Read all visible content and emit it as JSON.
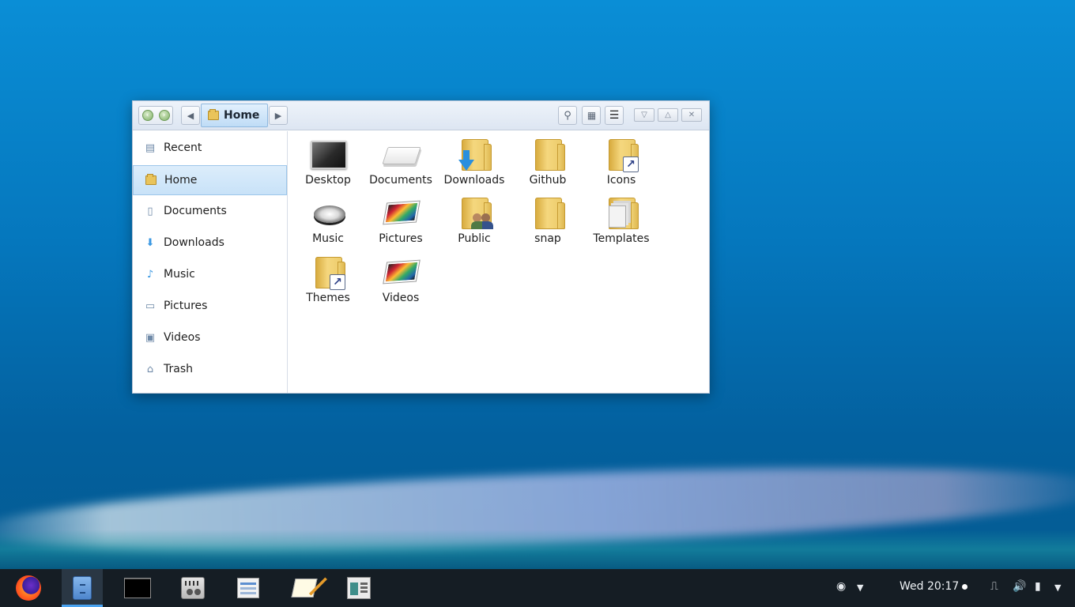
{
  "window": {
    "location": "Home"
  },
  "sidebar": {
    "items": [
      {
        "label": "Recent",
        "icon": "recent-icon"
      },
      {
        "label": "Home",
        "icon": "home-folder-icon"
      },
      {
        "label": "Documents",
        "icon": "document-icon"
      },
      {
        "label": "Downloads",
        "icon": "download-icon"
      },
      {
        "label": "Music",
        "icon": "music-note-icon"
      },
      {
        "label": "Pictures",
        "icon": "picture-icon"
      },
      {
        "label": "Videos",
        "icon": "video-icon"
      },
      {
        "label": "Trash",
        "icon": "trash-icon"
      }
    ],
    "active_index": 1
  },
  "files": [
    {
      "label": "Desktop",
      "icon": "desktop-icon"
    },
    {
      "label": "Documents",
      "icon": "documents-folder-icon"
    },
    {
      "label": "Downloads",
      "icon": "downloads-folder-icon"
    },
    {
      "label": "Github",
      "icon": "folder-icon"
    },
    {
      "label": "Icons",
      "icon": "folder-link-icon"
    },
    {
      "label": "Music",
      "icon": "music-folder-icon"
    },
    {
      "label": "Pictures",
      "icon": "pictures-folder-icon"
    },
    {
      "label": "Public",
      "icon": "public-folder-icon"
    },
    {
      "label": "snap",
      "icon": "folder-icon"
    },
    {
      "label": "Templates",
      "icon": "templates-folder-icon"
    },
    {
      "label": "Themes",
      "icon": "folder-link-icon"
    },
    {
      "label": "Videos",
      "icon": "videos-folder-icon"
    }
  ],
  "taskbar": {
    "apps": [
      {
        "name": "firefox-icon"
      },
      {
        "name": "file-manager-icon"
      },
      {
        "name": "terminal-icon"
      },
      {
        "name": "audio-mixer-icon"
      },
      {
        "name": "form-app-icon"
      },
      {
        "name": "text-editor-icon"
      },
      {
        "name": "system-monitor-icon"
      }
    ],
    "clock": "Wed 20:17"
  },
  "colors": {
    "accent": "#4aa3f0",
    "selection": "#c8e2f8",
    "taskbar_bg": "#151d24"
  }
}
